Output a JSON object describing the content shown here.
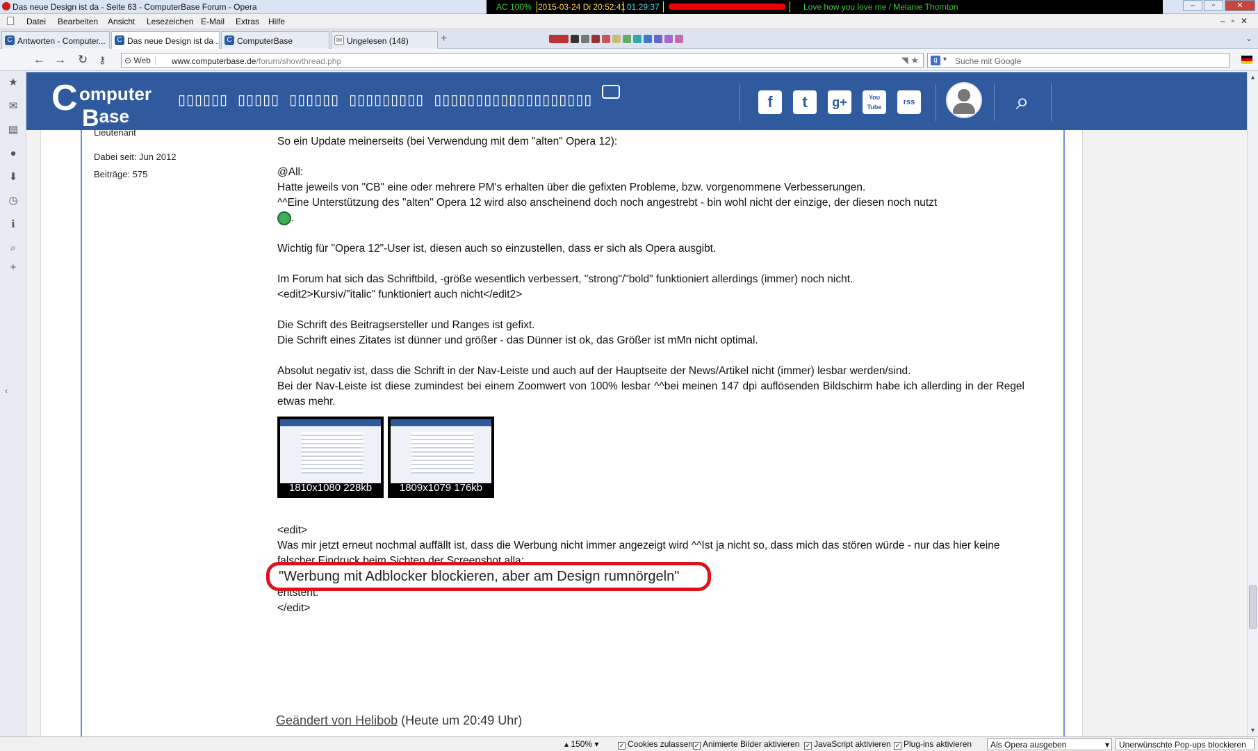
{
  "window": {
    "title": "Das neue Design ist da - Seite 63 - ComputerBase Forum - Opera",
    "status_items": [
      "AC 100%",
      "2015-03-24 Di 20:52:41",
      "01:29:37",
      "Love how you love me / Melanie Thornton"
    ]
  },
  "menu": [
    "Datei",
    "Bearbeiten",
    "Ansicht",
    "Lesezeichen",
    "E-Mail",
    "Extras",
    "Hilfe"
  ],
  "tabs": [
    {
      "label": "Antworten - Computer..."
    },
    {
      "label": "Das neue Design ist da ..."
    },
    {
      "label": "ComputerBase"
    },
    {
      "label": "Ungelesen (148)"
    }
  ],
  "address": {
    "web_label": "Web",
    "url_domain": "www.computerbase.de",
    "url_path": "/forum/showthread.php",
    "search_placeholder": "Suche mit Google"
  },
  "site": {
    "logo_text": [
      "C",
      "omputer",
      "ase"
    ],
    "nav": [
      "▯▯▯▯▯▯",
      "▯▯▯▯▯",
      "▯▯▯▯▯▯",
      "▯▯▯▯▯▯▯▯▯",
      "▯▯▯▯▯▯▯▯▯▯▯▯▯▯▯▯▯▯▯"
    ],
    "social": [
      "f",
      "t",
      "g+",
      "You Tube",
      "rss"
    ]
  },
  "user": {
    "rank": "Lieutenant",
    "joined_label": "Dabei seit:",
    "joined_value": "Jun 2012",
    "posts_label": "Beiträge:",
    "posts_value": "575"
  },
  "post": {
    "intro": "So ein Update meinerseits (bei Verwendung mit dem \"alten\" Opera 12):",
    "p1": [
      "@All:",
      "Hatte jeweils von \"CB\" eine oder mehrere PM's erhalten über die gefixten Probleme, bzw. vorgenommene Verbesserungen.",
      "^^Eine Unterstützung des \"alten\" Opera 12 wird also anscheinend doch noch angestrebt - bin wohl nicht der einzige, der diesen noch nutzt"
    ],
    "p2": "Wichtig für \"Opera 12\"-User ist, diesen auch so einzustellen, dass er sich als Opera ausgibt.",
    "p3": [
      "Im Forum hat sich das Schriftbild, -größe wesentlich verbessert, \"strong\"/\"bold\" funktioniert allerdings (immer) noch nicht.",
      "<edit2>Kursiv/\"italic\" funktioniert auch nicht</edit2>"
    ],
    "p4": [
      "Die Schrift des Beitragsersteller und Ranges ist gefixt.",
      "Die Schrift eines Zitates ist dünner und größer - das Dünner ist ok, das Größer ist mMn nicht optimal."
    ],
    "p5": [
      "Absolut negativ ist, dass die Schrift in der Nav-Leiste und auch auf der Hauptseite der News/Artikel nicht (immer) lesbar werden/sind.",
      "Bei der Nav-Leiste ist diese zumindest bei einem Zoomwert von 100% lesbar ^^bei meinen 147 dpi auflösenden Bildschirm habe ich allerding in der Regel etwas mehr."
    ],
    "thumbs": [
      "1810x1080 228kb",
      "1809x1079 176kb"
    ],
    "edit_open": "<edit>",
    "edit_line1": "Was mir jetzt erneut nochmal auffällt ist, dass die Werbung nicht immer angezeigt wird ^^Ist ja nicht so, dass mich das stören würde - nur das hier keine falscher Eindruck beim Sichten der Screenshot alla:",
    "highlight": "\"Werbung mit Adblocker blockieren, aber am Design rumnörgeln\"",
    "edit_line3": "entsteht.",
    "edit_close": "</edit>",
    "edited_by": "Geändert von Helibob",
    "edited_time": "(Heute um 20:49 Uhr)"
  },
  "statusbar": {
    "zoom": "150%",
    "cookies": "Cookies zulassen",
    "anim": "Animierte Bilder aktivieren",
    "js": "JavaScript aktivieren",
    "plugins": "Plug-ins aktivieren",
    "identify": "Als Opera ausgeben",
    "popups": "Unerwünschte Pop-ups blockieren"
  },
  "colors": {
    "accent": "#2f5a9d",
    "highlight_ring": "#e0101a"
  }
}
